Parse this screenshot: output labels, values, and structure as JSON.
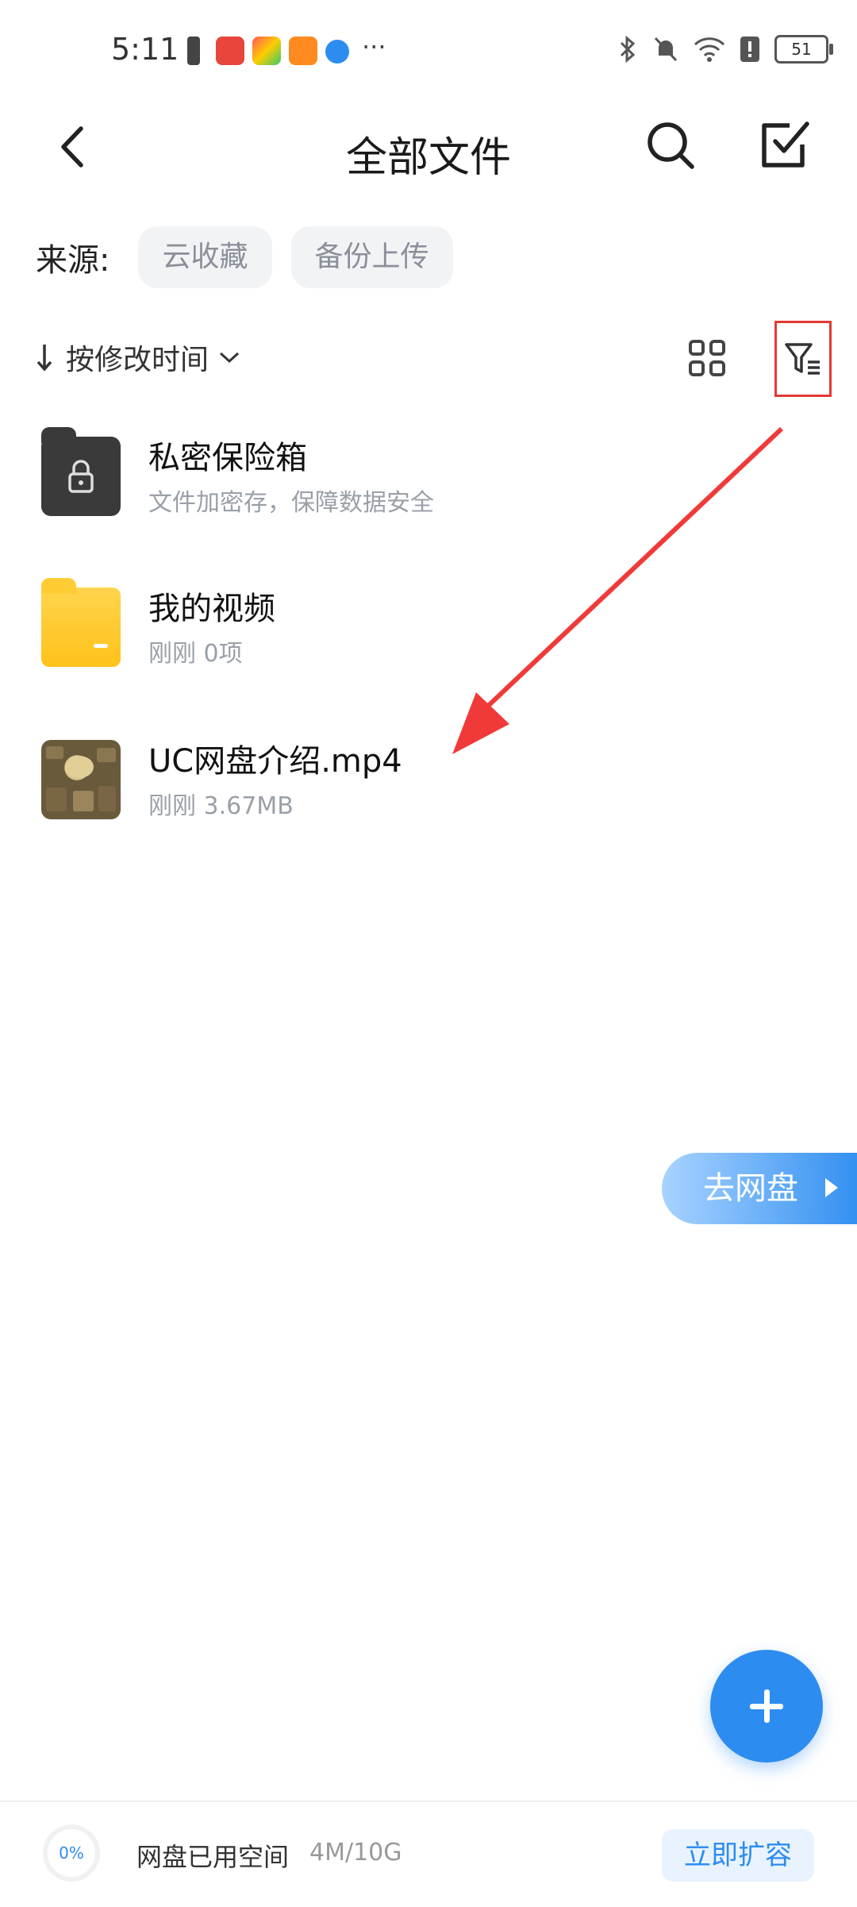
{
  "status_bar": {
    "time": "5:11",
    "battery": "51"
  },
  "header": {
    "title": "全部文件"
  },
  "source": {
    "label": "来源:",
    "chips": [
      "云收藏",
      "备份上传"
    ]
  },
  "sort": {
    "label": "按修改时间"
  },
  "files": [
    {
      "name": "私密保险箱",
      "meta": "文件加密存，保障数据安全"
    },
    {
      "name": "我的视频",
      "meta": "刚刚 0项"
    },
    {
      "name": "UC网盘介绍.mp4",
      "meta": "刚刚 3.67MB"
    }
  ],
  "goto_drive": {
    "label": "去网盘"
  },
  "storage": {
    "percent": "0%",
    "label": "网盘已用空间",
    "value": "4M/10G",
    "expand_label": "立即扩容"
  },
  "colors": {
    "accent": "#2d8cf0",
    "annotation": "#e53935"
  }
}
